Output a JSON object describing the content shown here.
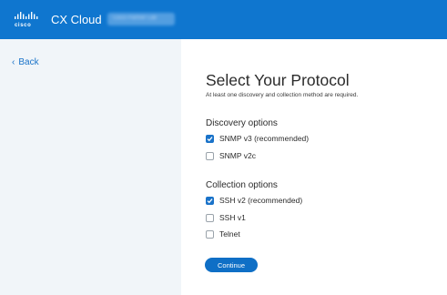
{
  "header": {
    "brand_word": "cisco",
    "app_title": "CX Cloud",
    "account_blurred": "Cisco Partner Lab"
  },
  "sidebar": {
    "back_label": "Back",
    "back_icon": "chevron-left-icon"
  },
  "main": {
    "title": "Select Your Protocol",
    "subtitle": "At least one discovery and collection method are required.",
    "discovery": {
      "title": "Discovery options",
      "options": [
        {
          "label": "SNMP v3 (recommended)",
          "checked": true
        },
        {
          "label": "SNMP v2c",
          "checked": false
        }
      ]
    },
    "collection": {
      "title": "Collection options",
      "options": [
        {
          "label": "SSH v2 (recommended)",
          "checked": true
        },
        {
          "label": "SSH v1",
          "checked": false
        },
        {
          "label": "Telnet",
          "checked": false
        }
      ]
    },
    "continue_label": "Continue"
  },
  "colors": {
    "header_bg": "#0f76cf",
    "accent": "#1a73c9",
    "sidebar_bg": "#f1f5f9"
  }
}
